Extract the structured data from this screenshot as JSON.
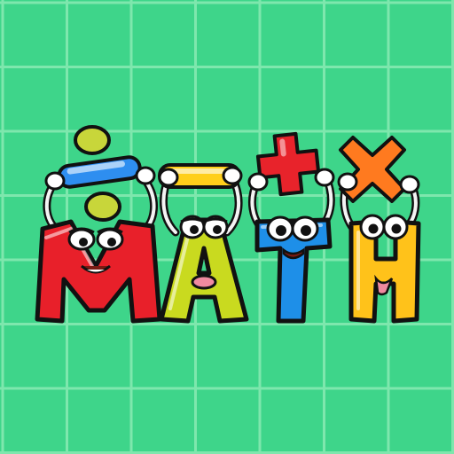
{
  "logo": {
    "letters": [
      "M",
      "A",
      "T",
      "H"
    ],
    "operators": [
      "÷",
      "−",
      "+",
      "×"
    ]
  },
  "colors": {
    "background": "#3ed58a",
    "grid_line": "#7ee7ad",
    "outline": "#111111",
    "m_letter": "#e8202a",
    "a_letter": "#c9da1f",
    "t_letter": "#1e8fe8",
    "h_letter": "#ffc21a",
    "divide_dots": "#c8d63a",
    "divide_bar": "#2e8ef0",
    "minus_bar": "#ffcf1a",
    "plus_sign": "#e8232b",
    "times_sign": "#ff7a1f"
  }
}
